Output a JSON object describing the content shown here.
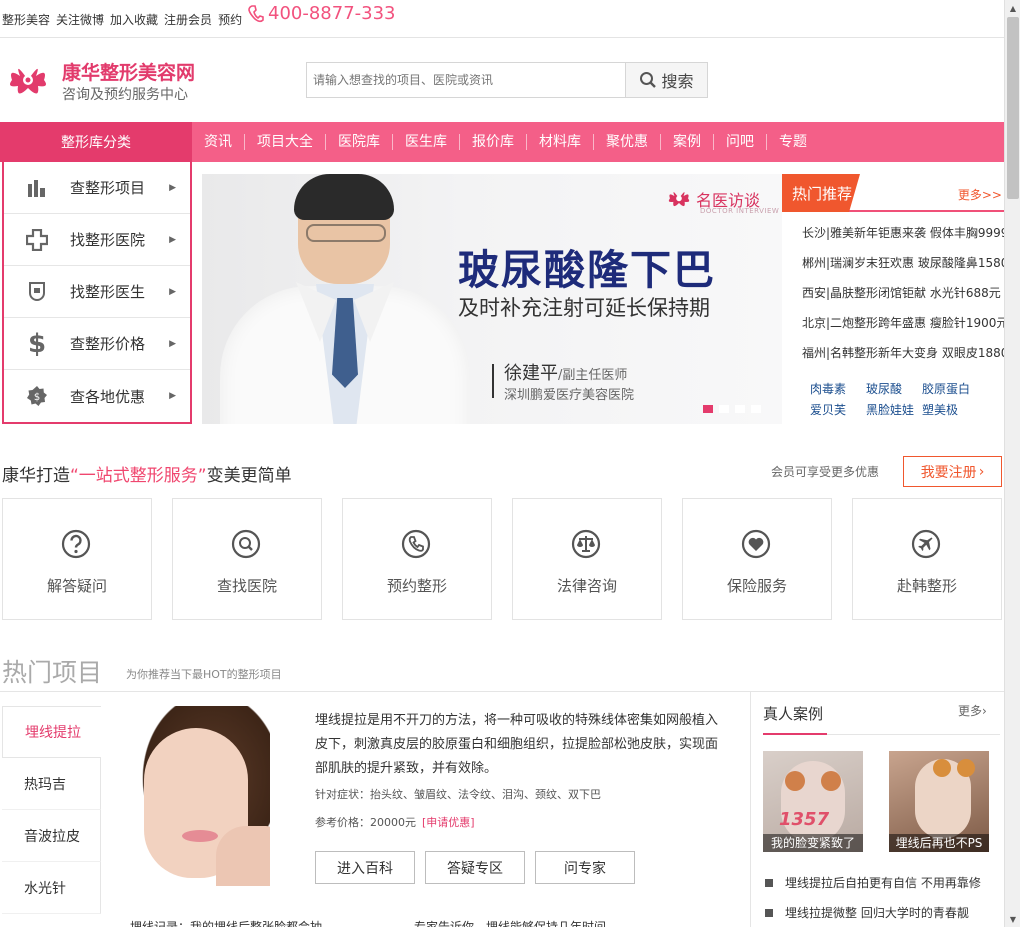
{
  "topbar": {
    "links": [
      "整形美容",
      "关注微博",
      "加入收藏",
      "注册会员",
      "预约"
    ],
    "phone": "400-8877-333"
  },
  "logo": {
    "title": "康华整形美容网",
    "subtitle": "咨询及预约服务中心"
  },
  "search": {
    "placeholder": "请输入想查找的项目、医院或资讯",
    "button": "搜索"
  },
  "nav": {
    "category": "整形库分类",
    "items": [
      "资讯",
      "项目大全",
      "医院库",
      "医生库",
      "报价库",
      "材料库",
      "聚优惠",
      "案例",
      "问吧",
      "专题"
    ]
  },
  "categories": [
    {
      "label": "查整形项目",
      "icon": "chart-bars-icon"
    },
    {
      "label": "找整形医院",
      "icon": "hospital-cross-icon"
    },
    {
      "label": "找整形医生",
      "icon": "doctor-icon"
    },
    {
      "label": "查整形价格",
      "icon": "dollar-icon"
    },
    {
      "label": "查各地优惠",
      "icon": "discount-badge-icon"
    }
  ],
  "banner": {
    "badge": "名医访谈",
    "badge_en": "DOCTOR INTERVIEW",
    "title": "玻尿酸隆下巴",
    "subtitle": "及时补充注射可延长保持期",
    "doctor_name": "徐建平",
    "doctor_title": "/副主任医师",
    "hospital": "深圳鹏爱医疗美容医院",
    "slide_count": 4,
    "active_slide": 1
  },
  "hot": {
    "title": "热门推荐",
    "more": "更多>>",
    "items": [
      "长沙|雅美新年钜惠来袭  假体丰胸9999",
      "郴州|瑞澜岁末狂欢惠  玻尿酸隆鼻1580",
      "西安|晶肤整形闭馆钜献  水光针688元",
      "北京|二炮整形跨年盛惠  瘦脸针1900元",
      "福州|名韩整形新年大变身  双眼皮1880"
    ],
    "tags": [
      "肉毒素",
      "玻尿酸",
      "胶原蛋白",
      "爱贝芙",
      "黑脸娃娃",
      "塑美极"
    ]
  },
  "onestop": {
    "title_pre": "康华打造",
    "title_hl": "“一站式整形服务”",
    "title_post": "变美更简单",
    "note": "会员可享受更多优惠",
    "register": "我要注册",
    "services": [
      {
        "label": "解答疑问",
        "icon": "question-icon"
      },
      {
        "label": "查找医院",
        "icon": "search-hospital-icon"
      },
      {
        "label": "预约整形",
        "icon": "phone-icon"
      },
      {
        "label": "法律咨询",
        "icon": "scales-icon"
      },
      {
        "label": "保险服务",
        "icon": "heart-icon"
      },
      {
        "label": "赴韩整形",
        "icon": "airplane-icon"
      }
    ]
  },
  "hot_projects": {
    "title": "热门项目",
    "subtitle": "为你推荐当下最HOT的整形项目",
    "tabs": [
      "埋线提拉",
      "热玛吉",
      "音波拉皮",
      "水光针"
    ],
    "active_tab": 0,
    "description": "埋线提拉是用不开刀的方法，将一种可吸收的特殊线体密集如网般植入皮下，刺激真皮层的胶原蛋白和细胞组织，拉提脸部松弛皮肤，实现面部肌肤的提升紧致，并有效除。",
    "symptoms": "针对症状：抬头纹、皱眉纹、法令纹、泪沟、颈纹、双下巴",
    "price": "参考价格：20000元",
    "apply": "[申请优惠]",
    "buttons": [
      "进入百科",
      "答疑专区",
      "问专家"
    ],
    "bottom_items": [
      "埋线记录：我的埋线后整张脸都会抽",
      "专家告诉你，埋线能够保持几年时间"
    ]
  },
  "cases": {
    "title": "真人案例",
    "more": "更多",
    "images": [
      {
        "caption": "我的脸变紧致了",
        "overlay": "1357"
      },
      {
        "caption": "埋线后再也不PS",
        "overlay": ""
      }
    ],
    "items": [
      "埋线提拉后自拍更有自信  不用再靠修",
      "埋线拉提微整  回归大学时的青春靓"
    ]
  },
  "colors": {
    "brand": "#e43b6c",
    "nav": "#f45f88",
    "accent": "#f0572e",
    "link": "#1c4f8f"
  }
}
